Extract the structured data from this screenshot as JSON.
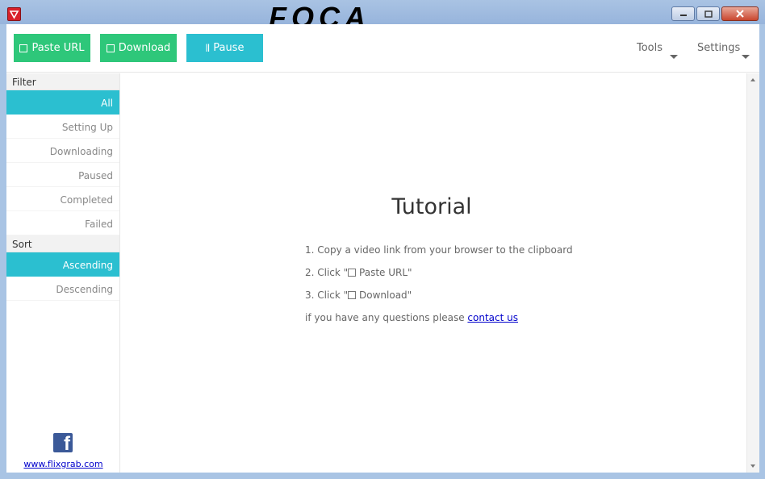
{
  "window": {
    "logo_text": "FOCA"
  },
  "toolbar": {
    "paste_url_label": "Paste URL",
    "download_label": "Download",
    "pause_label": "Pause",
    "pause_icon": "ll",
    "tools_label": "Tools",
    "settings_label": "Settings"
  },
  "sidebar": {
    "filter_header": "Filter",
    "filter_items": [
      "All",
      "Setting Up",
      "Downloading",
      "Paused",
      "Completed",
      "Failed"
    ],
    "sort_header": "Sort",
    "sort_items": [
      "Ascending",
      "Descending"
    ],
    "facebook_letter": "f",
    "website": "www.flixgrab.com"
  },
  "tutorial": {
    "title": "Tutorial",
    "step1": "1. Copy a video link from your browser to the clipboard",
    "step2_prefix": "2. Click \"",
    "step2_label": " Paste URL",
    "step2_suffix": "\"",
    "step3_prefix": "3. Click \"",
    "step3_label": " Download",
    "step3_suffix": "\"",
    "questions_text": "if you have any questions please ",
    "contact_link": "contact us"
  },
  "colors": {
    "green": "#2ec77a",
    "teal": "#2bbfd0",
    "link": "#0000cc"
  }
}
